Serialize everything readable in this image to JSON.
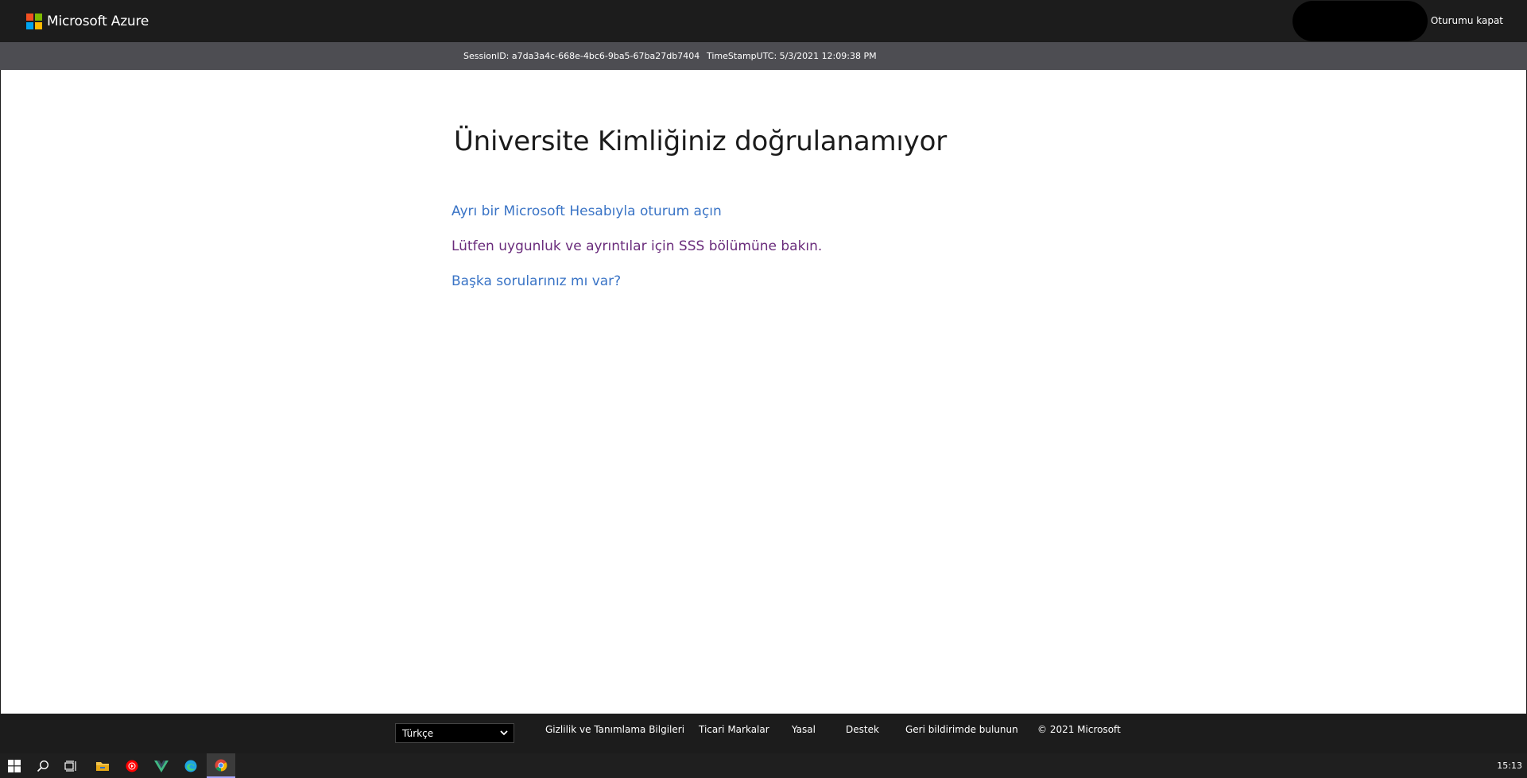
{
  "header": {
    "brand": "Microsoft Azure",
    "signout_label": "Oturumu kapat",
    "logo_colors": [
      "#f25022",
      "#7fba00",
      "#00a4ef",
      "#ffb900"
    ]
  },
  "session": {
    "session_id": "SessionID: a7da3a4c-668e-4bc6-9ba5-67ba27db7404",
    "timestamp": "TimeStampUTC: 5/3/2021 12:09:38 PM"
  },
  "main": {
    "title": "Üniversite Kimliğiniz doğrulanamıyor",
    "links": [
      "Ayrı bir Microsoft Hesabıyla oturum açın",
      "Lütfen uygunluk ve ayrıntılar için SSS bölümüne bakın.",
      "Başka sorularınız mı var?"
    ]
  },
  "footer": {
    "language_selected": "Türkçe",
    "privacy": "Gizlilik ve Tanımlama Bilgileri",
    "trademarks": "Ticari Markalar",
    "legal": "Yasal",
    "support": "Destek",
    "feedback": "Geri bildirimde bulunun",
    "copyright": "© 2021 Microsoft"
  },
  "taskbar": {
    "icons": [
      "windows-start-icon",
      "search-icon",
      "task-view-icon",
      "file-explorer-icon",
      "youtube-music-icon",
      "vue-icon",
      "edge-icon",
      "chrome-icon"
    ],
    "clock": "15:13"
  },
  "colors": {
    "header_bg": "#1c1c1c",
    "session_bg": "#4d4d52",
    "link_blue": "#3a74c6",
    "link_visited": "#6a2c7c"
  }
}
